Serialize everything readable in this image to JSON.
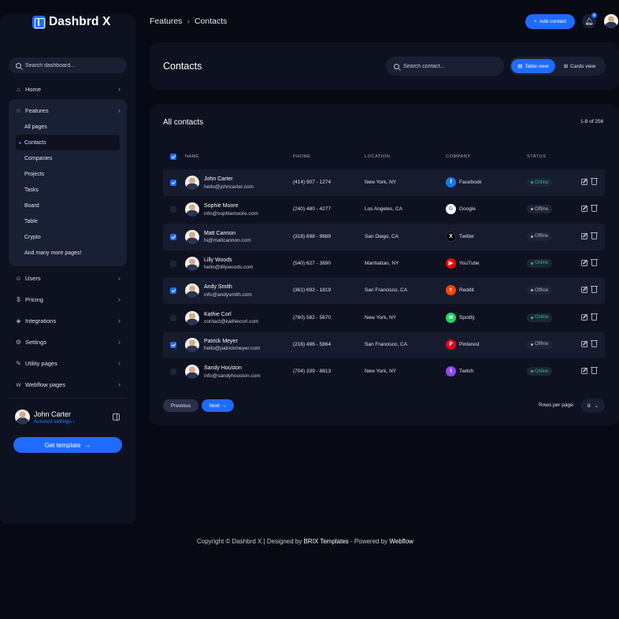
{
  "sidebar": {
    "brand": "Dashbrd X",
    "search_placeholder": "Search dashboard...",
    "nav": [
      {
        "label": "Home",
        "icon": "home-icon"
      },
      {
        "label": "Features",
        "icon": "star-icon"
      },
      {
        "label": "Users",
        "icon": "user-icon"
      },
      {
        "label": "Pricing",
        "icon": "dollar-icon"
      },
      {
        "label": "Integrations",
        "icon": "puzzle-icon"
      },
      {
        "label": "Settings",
        "icon": "gear-icon"
      },
      {
        "label": "Utility pages",
        "icon": "wrench-icon"
      },
      {
        "label": "Webflow pages",
        "icon": "webflow-icon"
      }
    ],
    "features_sub": [
      "All pages",
      "Contacts",
      "Companies",
      "Projects",
      "Tasks",
      "Board",
      "Table",
      "Crypto",
      "And many more pages!"
    ],
    "active_sub": "Contacts",
    "user": {
      "name": "John Carter",
      "link": "Account settings"
    },
    "cta": "Get template"
  },
  "header": {
    "breadcrumb": [
      "Features",
      "Contacts"
    ],
    "add_contact": "Add contact",
    "notifications": "4"
  },
  "contacts_card": {
    "title": "Contacts",
    "search_placeholder": "Search contact...",
    "views": [
      "Table view",
      "Cards view"
    ],
    "active_view": "Table view"
  },
  "table": {
    "title": "All contacts",
    "count": "1-8 of 256",
    "columns": [
      "NAME",
      "PHONE",
      "LOCATION",
      "COMPANY",
      "STATUS"
    ],
    "rows": [
      {
        "name": "John Carter",
        "email": "hello@johncarter.com",
        "phone": "(414) 907 - 1274",
        "location": "New York, NY",
        "company": "Facebook",
        "company_color": "#1877f2",
        "company_icon": "f",
        "status": "Online",
        "checked": true
      },
      {
        "name": "Sophie Moore",
        "email": "info@sophiemoore.com",
        "phone": "(240) 480 - 4277",
        "location": "Los Angeles, CA",
        "company": "Google",
        "company_color": "#ffffff",
        "company_icon": "G",
        "status": "Offline",
        "checked": false
      },
      {
        "name": "Matt Cannon",
        "email": "hi@mattcannon.com",
        "phone": "(318) 698 - 9689",
        "location": "San Diego, CA",
        "company": "Twitter",
        "company_color": "#000000",
        "company_icon": "X",
        "status": "Offline",
        "checked": true
      },
      {
        "name": "Lilly Woods",
        "email": "hello@lillywoods.com",
        "phone": "(540) 627 - 3890",
        "location": "Manhattan, NY",
        "company": "YouTube",
        "company_color": "#ff0000",
        "company_icon": "▶",
        "status": "Online",
        "checked": false
      },
      {
        "name": "Andy Smith",
        "email": "info@andysmith.com",
        "phone": "(361) 692 - 1819",
        "location": "San Francisco, CA",
        "company": "Reddit",
        "company_color": "#ff4500",
        "company_icon": "r",
        "status": "Offline",
        "checked": true
      },
      {
        "name": "Kathie Corl",
        "email": "contact@kathiecorl.com",
        "phone": "(760) 582 - 5670",
        "location": "New York, NY",
        "company": "Spotify",
        "company_color": "#1ed760",
        "company_icon": "≋",
        "status": "Online",
        "checked": false
      },
      {
        "name": "Patrick Meyer",
        "email": "hello@patrickmeyer.com",
        "phone": "(216) 496 - 5864",
        "location": "San Francisco, CA",
        "company": "Pinterest",
        "company_color": "#e60023",
        "company_icon": "P",
        "status": "Offline",
        "checked": true
      },
      {
        "name": "Sandy Houston",
        "email": "info@sandyhouston.com",
        "phone": "(704) 339 - 8813",
        "location": "New York, NY",
        "company": "Twitch",
        "company_color": "#9146ff",
        "company_icon": "t",
        "status": "Online",
        "checked": false
      }
    ],
    "prev": "Previous",
    "next": "Next",
    "rows_per_page_label": "Rows per page:",
    "rows_per_page": "8"
  },
  "footer": {
    "copyright": "Copyright © Dashbrd X | Designed by ",
    "designer": "BRIX Templates",
    "powered": " - Powered by ",
    "platform": "Webflow"
  },
  "colors": {
    "accent": "#1f6bff",
    "online": "#19c27a",
    "offline": "#aab0c0",
    "background": "#070a13",
    "card": "#0d1120"
  }
}
